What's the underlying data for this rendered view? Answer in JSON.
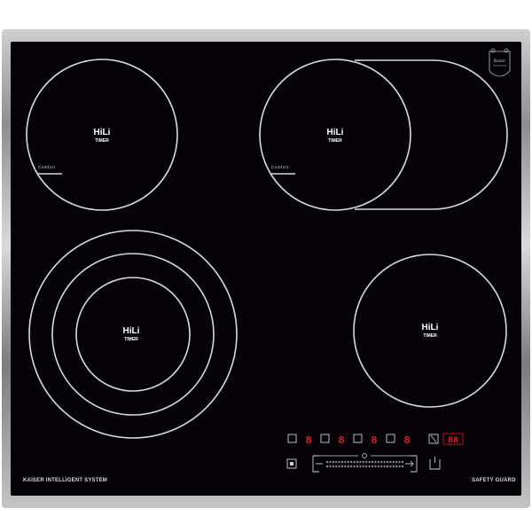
{
  "hob": {
    "zones": [
      {
        "id": "front-left-top",
        "label": "HiLi",
        "sub": "TIMER",
        "comfort": "Comfort"
      },
      {
        "id": "rear-right-oval",
        "label": "HiLi",
        "sub": "TIMER",
        "comfort": "Comfort"
      },
      {
        "id": "triple-ring",
        "label": "HiLi",
        "sub": "TIMER"
      },
      {
        "id": "front-right",
        "label": "HiLi",
        "sub": "TIMER"
      }
    ],
    "brand_left": "KAISER INTELLIGENT SYSTEM",
    "brand_right": "SAFETY GUARD",
    "logo_text": "Kaiser"
  },
  "colors": {
    "glass": "#050308",
    "rings": "#d9d9d9",
    "display_red": "#d62020"
  },
  "controls": {
    "zone_displays": [
      "8",
      "8",
      "8",
      "8"
    ],
    "timer_display": "88",
    "icons": [
      "lock-icon",
      "clock-icon",
      "power-icon",
      "minus-icon",
      "plus-icon",
      "key-icon"
    ]
  }
}
